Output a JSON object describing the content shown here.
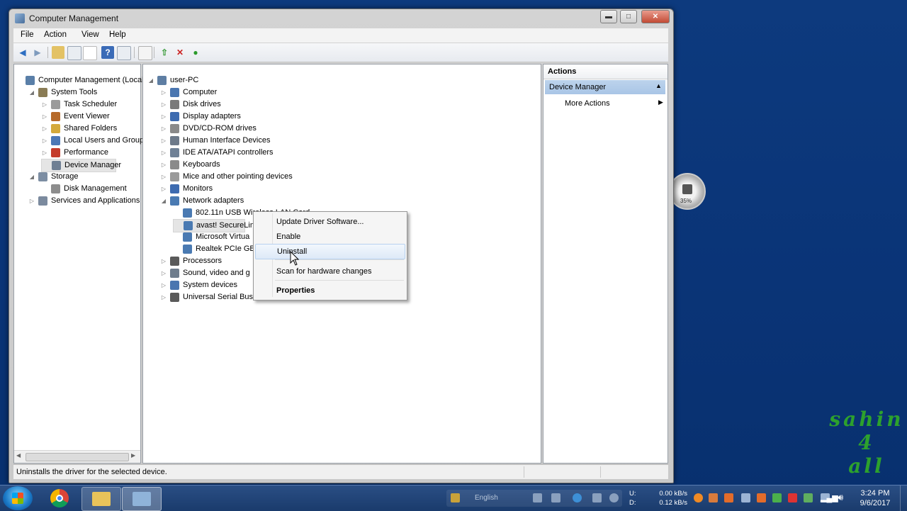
{
  "window": {
    "title": "Computer Management",
    "buttons": {
      "minimize": "▬",
      "maximize": "□",
      "close": "✕"
    }
  },
  "menu": [
    "File",
    "Action",
    "View",
    "Help"
  ],
  "toolbar": {
    "icons": [
      "back-icon",
      "forward-icon",
      "up-icon",
      "show-hide-console-tree-icon",
      "properties-icon",
      "help-icon",
      "show-action-pane-icon",
      "scan-hardware-icon",
      "update-driver-icon",
      "uninstall-icon",
      "enable-device-icon"
    ]
  },
  "left_tree": [
    {
      "label": "Computer Management (Local",
      "level": 0,
      "expander": "",
      "icon": "computer-management-icon",
      "color": "#5a7fa8"
    },
    {
      "label": "System Tools",
      "level": 1,
      "expander": "◢",
      "icon": "system-tools-icon",
      "color": "#8a7c55"
    },
    {
      "label": "Task Scheduler",
      "level": 2,
      "expander": "▷",
      "icon": "clock-icon",
      "color": "#9b9b9b"
    },
    {
      "label": "Event Viewer",
      "level": 2,
      "expander": "▷",
      "icon": "event-viewer-icon",
      "color": "#b66a2a"
    },
    {
      "label": "Shared Folders",
      "level": 2,
      "expander": "▷",
      "icon": "shared-folder-icon",
      "color": "#d4a93b"
    },
    {
      "label": "Local Users and Groups",
      "level": 2,
      "expander": "▷",
      "icon": "users-icon",
      "color": "#4c78b6"
    },
    {
      "label": "Performance",
      "level": 2,
      "expander": "▷",
      "icon": "performance-icon",
      "color": "#c43c2b"
    },
    {
      "label": "Device Manager",
      "level": 2,
      "expander": "",
      "icon": "device-manager-icon",
      "color": "#6f7f93",
      "selected": true
    },
    {
      "label": "Storage",
      "level": 1,
      "expander": "◢",
      "icon": "storage-icon",
      "color": "#7d8ea3"
    },
    {
      "label": "Disk Management",
      "level": 2,
      "expander": "",
      "icon": "disk-icon",
      "color": "#8d8d8d"
    },
    {
      "label": "Services and Applications",
      "level": 1,
      "expander": "▷",
      "icon": "services-icon",
      "color": "#7b8a9e"
    }
  ],
  "device_tree": [
    {
      "label": "user-PC",
      "level": 0,
      "expander": "◢",
      "icon": "computer-icon",
      "color": "#5e7ea3"
    },
    {
      "label": "Computer",
      "level": 1,
      "expander": "▷",
      "icon": "computer-icon",
      "color": "#4a76b0"
    },
    {
      "label": "Disk drives",
      "level": 1,
      "expander": "▷",
      "icon": "disk-drive-icon",
      "color": "#7a7a7a"
    },
    {
      "label": "Display adapters",
      "level": 1,
      "expander": "▷",
      "icon": "display-adapter-icon",
      "color": "#3d6bb0"
    },
    {
      "label": "DVD/CD-ROM drives",
      "level": 1,
      "expander": "▷",
      "icon": "dvd-drive-icon",
      "color": "#8a8a8a"
    },
    {
      "label": "Human Interface Devices",
      "level": 1,
      "expander": "▷",
      "icon": "hid-icon",
      "color": "#6d7a8a"
    },
    {
      "label": "IDE ATA/ATAPI controllers",
      "level": 1,
      "expander": "▷",
      "icon": "ide-controller-icon",
      "color": "#6f8196"
    },
    {
      "label": "Keyboards",
      "level": 1,
      "expander": "▷",
      "icon": "keyboard-icon",
      "color": "#8a8a8a"
    },
    {
      "label": "Mice and other pointing devices",
      "level": 1,
      "expander": "▷",
      "icon": "mouse-icon",
      "color": "#9a9a9a"
    },
    {
      "label": "Monitors",
      "level": 1,
      "expander": "▷",
      "icon": "monitor-icon",
      "color": "#3d6bb0"
    },
    {
      "label": "Network adapters",
      "level": 1,
      "expander": "◢",
      "icon": "network-adapter-icon",
      "color": "#4a7ab2"
    },
    {
      "label": "802.11n USB Wireless LAN Card",
      "level": 2,
      "expander": "",
      "icon": "network-card-icon",
      "color": "#4a7ab2"
    },
    {
      "label": "avast! SecureLin",
      "level": 2,
      "expander": "",
      "icon": "network-card-icon",
      "color": "#4a7ab2",
      "selected": true
    },
    {
      "label": "Microsoft Virtua",
      "level": 2,
      "expander": "",
      "icon": "network-card-icon",
      "color": "#4a7ab2"
    },
    {
      "label": "Realtek PCIe GB",
      "level": 2,
      "expander": "",
      "icon": "network-card-icon",
      "color": "#4a7ab2"
    },
    {
      "label": "Processors",
      "level": 1,
      "expander": "▷",
      "icon": "processor-icon",
      "color": "#5a5a5a"
    },
    {
      "label": "Sound, video and g",
      "level": 1,
      "expander": "▷",
      "icon": "sound-icon",
      "color": "#6f7d8d"
    },
    {
      "label": "System devices",
      "level": 1,
      "expander": "▷",
      "icon": "system-devices-icon",
      "color": "#4a76b0"
    },
    {
      "label": "Universal Serial Bus",
      "level": 1,
      "expander": "▷",
      "icon": "usb-icon",
      "color": "#5a5a5a"
    }
  ],
  "actions": {
    "header": "Actions",
    "section": "Device Manager",
    "more": "More Actions"
  },
  "context_menu": [
    {
      "label": "Update Driver Software...",
      "bold": false
    },
    {
      "label": "Enable",
      "bold": false
    },
    {
      "label": "Uninstall",
      "bold": false,
      "highlighted": true
    },
    {
      "label": "Scan for hardware changes",
      "bold": false
    },
    {
      "label": "Properties",
      "bold": true
    }
  ],
  "status": "Uninstalls the driver for the selected device.",
  "taskbar": {
    "language": "English",
    "net_up_label": "U:",
    "net_down_label": "D:",
    "net_up": "0.00 kB/s",
    "net_down": "0.12 kB/s",
    "time": "3:24 PM",
    "date": "9/6/2017"
  },
  "gadget": {
    "percent": "35%"
  },
  "watermark": [
    "sahin",
    "4",
    "all"
  ],
  "colors": {
    "accent": "#b8d2ef",
    "desktop": "#0b3677",
    "watermark": "#2da12d"
  }
}
